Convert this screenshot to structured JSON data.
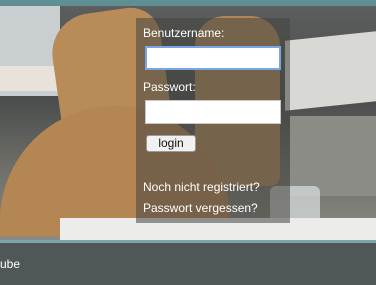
{
  "login_form": {
    "username_label": "Benutzername:",
    "username_value": "",
    "password_label": "Passwort:",
    "password_value": "",
    "login_button": "login",
    "register_link": "Noch nicht registriert?",
    "forgot_link": "Passwort vergessen?"
  },
  "footer": {
    "text": "ube"
  },
  "colors": {
    "accent": "#5f8f92",
    "focus": "#78a6e4",
    "footer_bg": "#4f5759"
  }
}
